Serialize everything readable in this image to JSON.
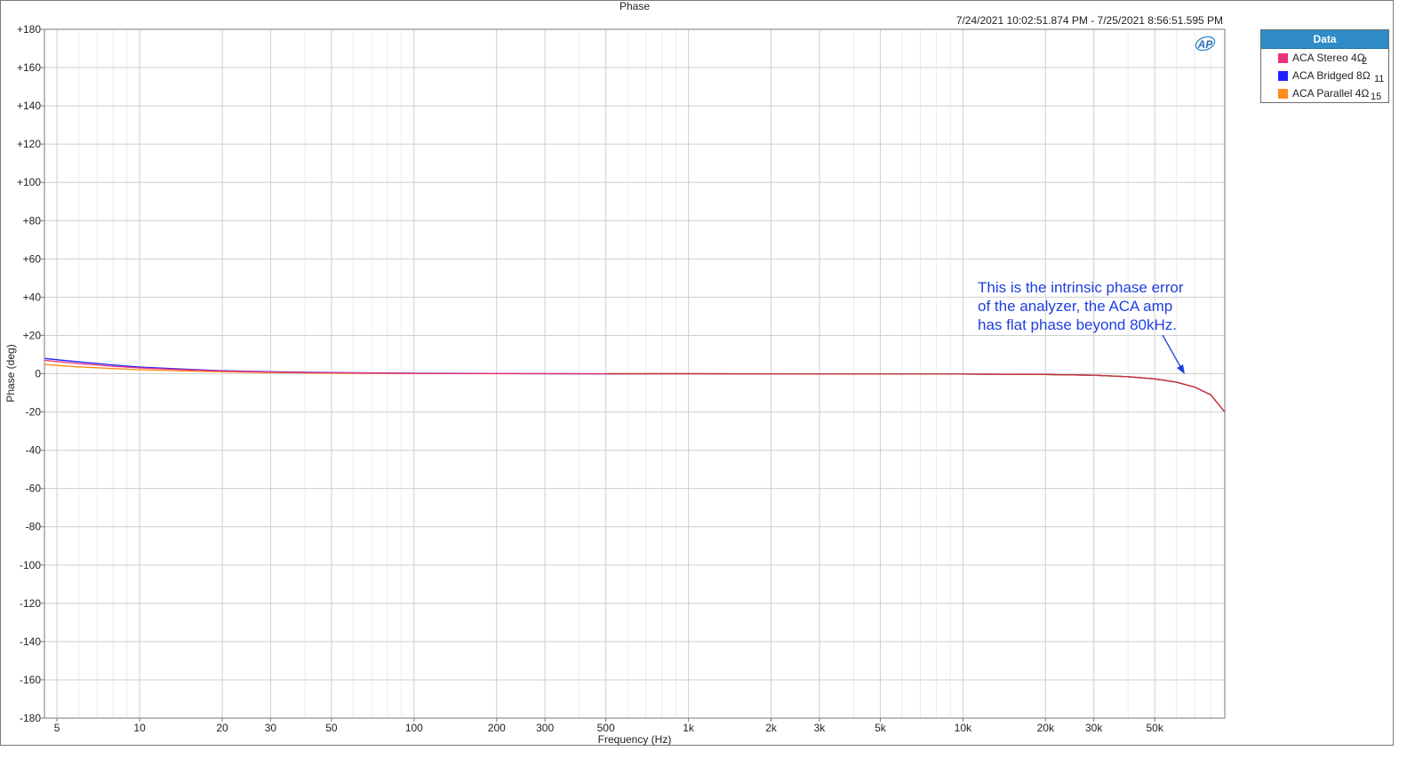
{
  "chart_data": {
    "type": "line",
    "title": "Phase",
    "timestamp": "7/24/2021 10:02:51.874 PM - 7/25/2021 8:56:51.595 PM",
    "xlabel": "Frequency (Hz)",
    "ylabel": "Phase (deg)",
    "xscale": "log",
    "xlim": [
      4.5,
      90000
    ],
    "ylim": [
      -180,
      180
    ],
    "grid": true,
    "x_ticks": [
      {
        "value": 5,
        "label": "5"
      },
      {
        "value": 10,
        "label": "10"
      },
      {
        "value": 20,
        "label": "20"
      },
      {
        "value": 30,
        "label": "30"
      },
      {
        "value": 50,
        "label": "50"
      },
      {
        "value": 100,
        "label": "100"
      },
      {
        "value": 200,
        "label": "200"
      },
      {
        "value": 300,
        "label": "300"
      },
      {
        "value": 500,
        "label": "500"
      },
      {
        "value": 1000,
        "label": "1k"
      },
      {
        "value": 2000,
        "label": "2k"
      },
      {
        "value": 3000,
        "label": "3k"
      },
      {
        "value": 5000,
        "label": "5k"
      },
      {
        "value": 10000,
        "label": "10k"
      },
      {
        "value": 20000,
        "label": "20k"
      },
      {
        "value": 30000,
        "label": "30k"
      },
      {
        "value": 50000,
        "label": "50k"
      }
    ],
    "y_ticks": [
      {
        "value": 180,
        "label": "+180"
      },
      {
        "value": 160,
        "label": "+160"
      },
      {
        "value": 140,
        "label": "+140"
      },
      {
        "value": 120,
        "label": "+120"
      },
      {
        "value": 100,
        "label": "+100"
      },
      {
        "value": 80,
        "label": "+80"
      },
      {
        "value": 60,
        "label": "+60"
      },
      {
        "value": 40,
        "label": "+40"
      },
      {
        "value": 20,
        "label": "+20"
      },
      {
        "value": 0,
        "label": "0"
      },
      {
        "value": -20,
        "label": "-20"
      },
      {
        "value": -40,
        "label": "-40"
      },
      {
        "value": -60,
        "label": "-60"
      },
      {
        "value": -80,
        "label": "-80"
      },
      {
        "value": -100,
        "label": "-100"
      },
      {
        "value": -120,
        "label": "-120"
      },
      {
        "value": -140,
        "label": "-140"
      },
      {
        "value": -160,
        "label": "-160"
      },
      {
        "value": -180,
        "label": "-180"
      }
    ],
    "legend": {
      "title": "Data",
      "position": "top-right, outside plot"
    },
    "series": [
      {
        "name": "ACA Stereo 4Ω",
        "id": "2",
        "color": "#e8337a",
        "points": [
          [
            4.5,
            7.0
          ],
          [
            6,
            5.3
          ],
          [
            8,
            3.9
          ],
          [
            10,
            3.0
          ],
          [
            15,
            2.0
          ],
          [
            20,
            1.4
          ],
          [
            30,
            0.9
          ],
          [
            50,
            0.5
          ],
          [
            100,
            0.2
          ],
          [
            200,
            0.1
          ],
          [
            500,
            0.0
          ],
          [
            1000,
            0.0
          ],
          [
            2000,
            -0.1
          ],
          [
            5000,
            -0.2
          ],
          [
            10000,
            -0.2
          ],
          [
            20000,
            -0.4
          ],
          [
            30000,
            -0.8
          ],
          [
            40000,
            -1.6
          ],
          [
            50000,
            -2.7
          ],
          [
            60000,
            -4.4
          ],
          [
            70000,
            -7.0
          ],
          [
            80000,
            -11.0
          ],
          [
            90000,
            -20.0
          ]
        ]
      },
      {
        "name": "ACA Bridged 8Ω",
        "id": "11",
        "color": "#2020ff",
        "points": [
          [
            4.5,
            8.0
          ],
          [
            6,
            6.2
          ],
          [
            8,
            4.6
          ],
          [
            10,
            3.5
          ],
          [
            15,
            2.3
          ],
          [
            20,
            1.6
          ],
          [
            30,
            1.0
          ],
          [
            50,
            0.6
          ],
          [
            100,
            0.3
          ],
          [
            200,
            0.1
          ],
          [
            500,
            -0.1
          ],
          [
            1000,
            0.0
          ],
          [
            2000,
            -0.1
          ],
          [
            5000,
            -0.2
          ],
          [
            10000,
            -0.2
          ],
          [
            20000,
            -0.4
          ],
          [
            30000,
            -0.8
          ],
          [
            40000,
            -1.6
          ],
          [
            50000,
            -2.7
          ],
          [
            60000,
            -4.4
          ],
          [
            70000,
            -7.0
          ],
          [
            80000,
            -11.0
          ],
          [
            90000,
            -20.0
          ]
        ]
      },
      {
        "name": "ACA Parallel 4Ω",
        "id": "15",
        "color": "#ff8c1a",
        "points": [
          [
            4.5,
            4.8
          ],
          [
            6,
            3.6
          ],
          [
            8,
            2.7
          ],
          [
            10,
            2.1
          ],
          [
            15,
            1.4
          ],
          [
            20,
            1.0
          ],
          [
            30,
            0.6
          ],
          [
            50,
            0.3
          ],
          [
            100,
            0.1
          ],
          [
            200,
            0.0
          ],
          [
            500,
            0.0
          ],
          [
            1000,
            0.0
          ],
          [
            2000,
            -0.1
          ],
          [
            5000,
            -0.2
          ],
          [
            10000,
            -0.2
          ],
          [
            20000,
            -0.4
          ],
          [
            30000,
            -0.8
          ],
          [
            40000,
            -1.6
          ],
          [
            50000,
            -2.7
          ],
          [
            60000,
            -4.4
          ],
          [
            70000,
            -7.0
          ],
          [
            80000,
            -11.0
          ],
          [
            90000,
            -20.0
          ]
        ]
      }
    ],
    "annotation": {
      "lines": [
        "This is the intrinsic phase error",
        "of the analyzer, the ACA amp",
        "has flat phase beyond 80kHz."
      ],
      "color": "#1f3fe0",
      "points_to": {
        "x": 60000,
        "y": -2
      }
    }
  }
}
